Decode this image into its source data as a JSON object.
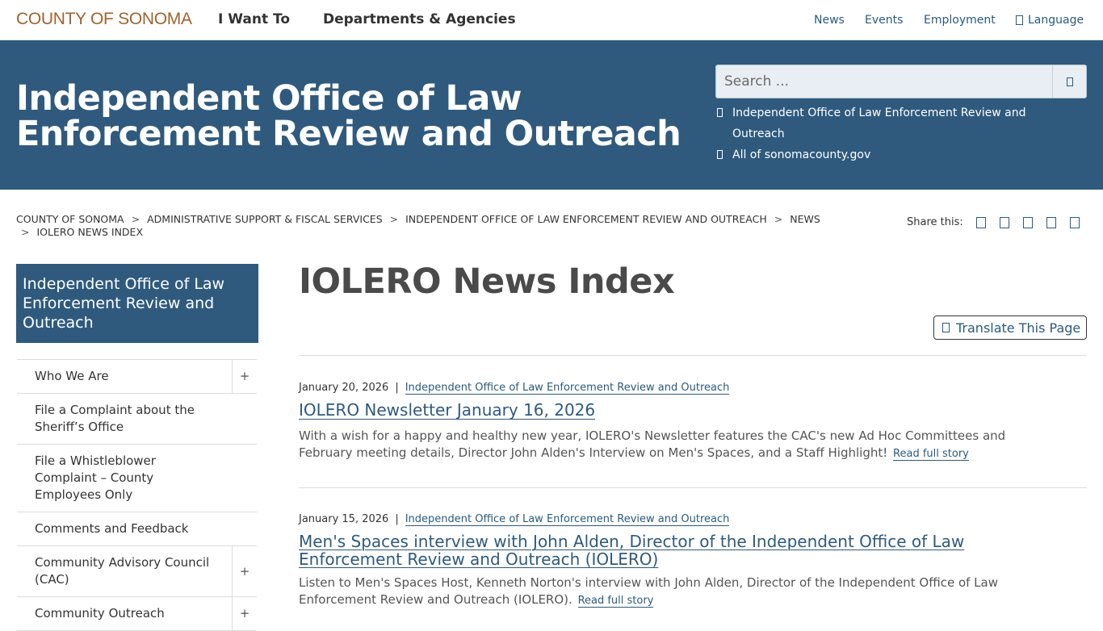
{
  "header": {
    "logo": "COUNTY OF SONOMA",
    "main_nav": [
      "I Want To",
      "Departments & Agencies"
    ],
    "util_nav": [
      "News",
      "Events",
      "Employment",
      "Language"
    ]
  },
  "banner": {
    "title": "Independent Office of Law Enforcement Review and Outreach",
    "search_placeholder": "Search ...",
    "scope_options": [
      "Independent Office of Law Enforcement Review and Outreach",
      "All of sonomacounty.gov"
    ]
  },
  "breadcrumb": {
    "items": [
      "COUNTY OF SONOMA",
      "ADMINISTRATIVE SUPPORT & FISCAL SERVICES",
      "INDEPENDENT OFFICE OF LAW ENFORCEMENT REVIEW AND OUTREACH",
      "NEWS",
      "IOLERO NEWS INDEX"
    ],
    "separator": ">"
  },
  "share": {
    "label": "Share this:",
    "icons": [
      "facebook-icon",
      "twitter-icon",
      "linkedin-icon",
      "email-icon",
      "print-icon"
    ]
  },
  "sidebar": {
    "heading": "Independent Office of Law Enforcement Review and Outreach",
    "items": [
      {
        "label": "Who We Are",
        "expandable": true
      },
      {
        "label": "File a Complaint about the Sheriff’s Office",
        "expandable": false
      },
      {
        "label": "File a Whistleblower Complaint – County Employees Only",
        "expandable": false
      },
      {
        "label": "Comments and Feedback",
        "expandable": false
      },
      {
        "label": "Community Advisory Council (CAC)",
        "expandable": true
      },
      {
        "label": "Community Outreach",
        "expandable": true
      }
    ],
    "expand_symbol": "+"
  },
  "main": {
    "title": "IOLERO News Index",
    "translate_label": "Translate This Page",
    "meta_pipe": "|",
    "articles": [
      {
        "date": "January 20, 2026",
        "department": "Independent Office of Law Enforcement Review and Outreach",
        "title": "IOLERO Newsletter January 16, 2026",
        "summary": "With a wish for a happy and healthy new year, IOLERO's Newsletter features the CAC's new Ad Hoc Committees and February meeting details, Director John Alden's Interview on Men's Spaces, and a Staff Highlight!",
        "read_more": "Read full story"
      },
      {
        "date": "January 15, 2026",
        "department": "Independent Office of Law Enforcement Review and Outreach",
        "title": "Men's Spaces interview with John Alden, Director of the Independent Office of Law Enforcement Review and Outreach (IOLERO)",
        "summary": "Listen to Men's Spaces Host, Kenneth Norton's interview with John Alden, Director of the Independent Office of Law Enforcement Review and Outreach (IOLERO).",
        "read_more": "Read full story"
      }
    ]
  },
  "colors": {
    "brand_blue": "#2f5a7e",
    "logo_brown": "#a0632c",
    "link_blue": "#2b5a7e"
  }
}
